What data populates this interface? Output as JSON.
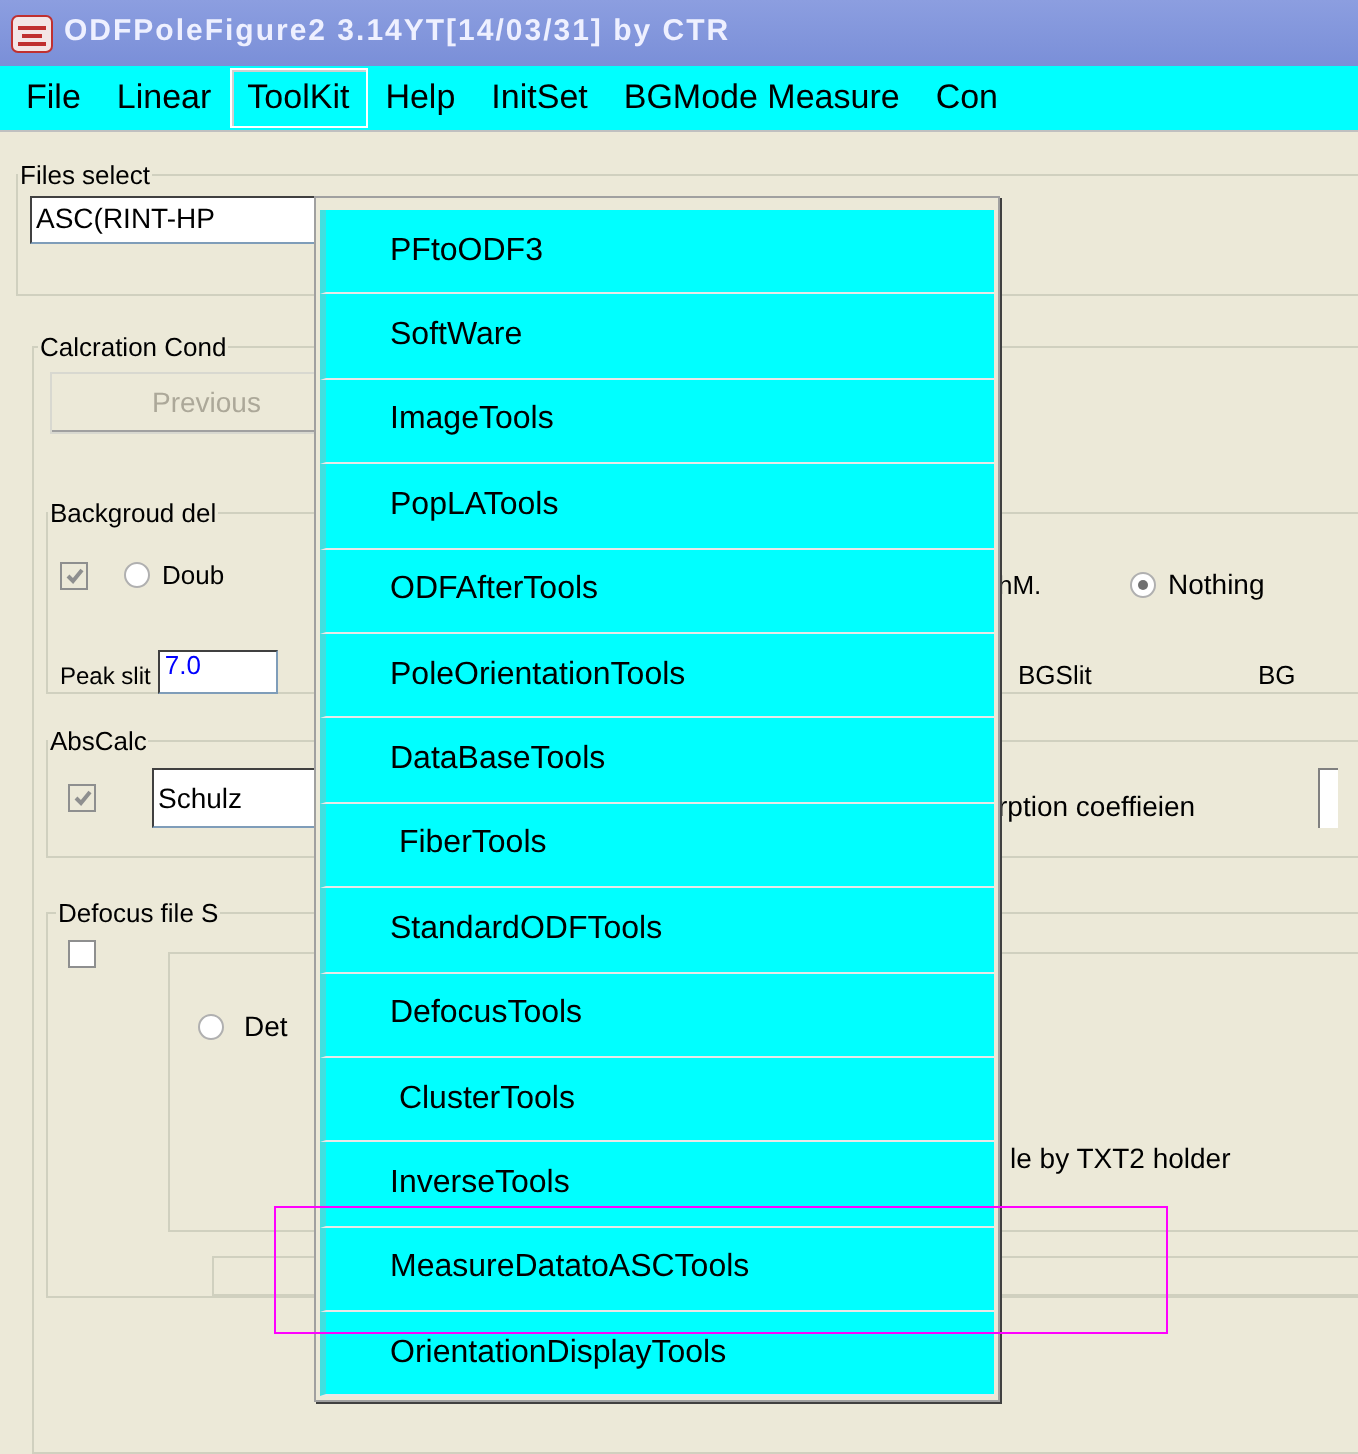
{
  "window": {
    "title": "ODFPoleFigure2 3.14YT[14/03/31] by CTR"
  },
  "menubar": [
    {
      "label": "File",
      "selected": false
    },
    {
      "label": "Linear",
      "selected": false
    },
    {
      "label": "ToolKit",
      "selected": true
    },
    {
      "label": "Help",
      "selected": false
    },
    {
      "label": "InitSet",
      "selected": false
    },
    {
      "label": "BGMode Measure",
      "selected": false
    },
    {
      "label": "Con",
      "selected": false
    }
  ],
  "dropdown": [
    {
      "label": "PFtoODF3"
    },
    {
      "label": "SoftWare"
    },
    {
      "label": "ImageTools"
    },
    {
      "label": "PopLATools"
    },
    {
      "label": "ODFAfterTools"
    },
    {
      "label": "PoleOrientationTools"
    },
    {
      "label": "DataBaseTools"
    },
    {
      "label": " FiberTools"
    },
    {
      "label": "StandardODFTools"
    },
    {
      "label": "DefocusTools"
    },
    {
      "label": " ClusterTools"
    },
    {
      "label": "InverseTools"
    },
    {
      "label": "MeasureDatatoASCTools"
    },
    {
      "label": "OrientationDisplayTools"
    }
  ],
  "files_select": {
    "label": "Files select",
    "value": "ASC(RINT-HP"
  },
  "calc_conditions": {
    "label": "Calcration Cond",
    "previous_button": {
      "label": "Previous",
      "disabled": true
    }
  },
  "background": {
    "label": "Backgroud del",
    "checkbox": {
      "checked": true
    },
    "radios": [
      {
        "label": "Doub",
        "selected": false
      },
      {
        "label": "Nothing",
        "selected": true
      }
    ],
    "text": "hM.",
    "peak_slit": {
      "label": "Peak slit",
      "value": "7.0"
    },
    "bgslit_text": "BGSlit",
    "bg_text": "BG"
  },
  "abs_calc": {
    "label": "AbsCalc",
    "checkbox": {
      "checked": true
    },
    "method": "Schulz",
    "text": "rption coeffieien"
  },
  "defocus": {
    "label": "Defocus file S",
    "checkbox": {
      "checked": false
    },
    "radio": {
      "label": "Det",
      "selected": false
    },
    "text": "le by TXT2 holder"
  }
}
